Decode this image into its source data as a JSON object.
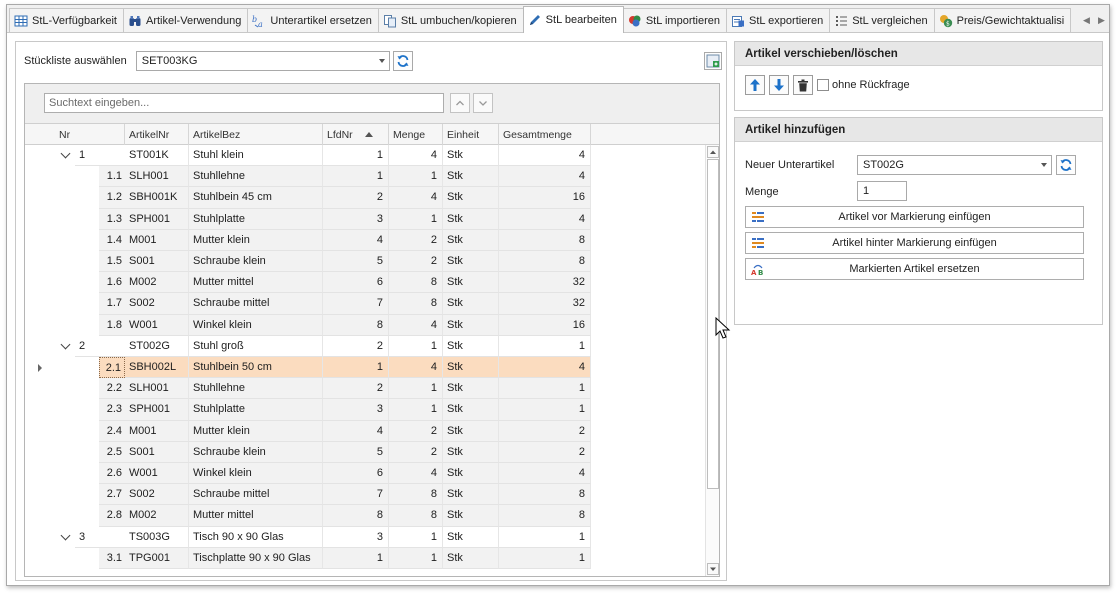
{
  "tabs": [
    {
      "label": "StL-Verfügbarkeit",
      "icon": "grid-icon",
      "active": false
    },
    {
      "label": "Artikel-Verwendung",
      "icon": "binoculars-icon",
      "active": false
    },
    {
      "label": "Unterartikel ersetzen",
      "icon": "replace-text-icon",
      "active": false
    },
    {
      "label": "StL umbuchen/kopieren",
      "icon": "copy-icon",
      "active": false
    },
    {
      "label": "StL bearbeiten",
      "icon": "pen-icon",
      "active": true
    },
    {
      "label": "StL importieren",
      "icon": "import-icon",
      "active": false
    },
    {
      "label": "StL exportieren",
      "icon": "export-icon",
      "active": false
    },
    {
      "label": "StL vergleichen",
      "icon": "compare-list-icon",
      "active": false
    },
    {
      "label": "Preis/Gewichtaktualisi",
      "icon": "price-icon",
      "active": false
    }
  ],
  "left": {
    "select_label": "Stückliste auswählen",
    "select_value": "SET003KG",
    "search_placeholder": "Suchtext eingeben...",
    "columns": {
      "nr": "Nr",
      "artikelnr": "ArtikelNr",
      "artikelbez": "ArtikelBez",
      "lfdnr": "LfdNr",
      "menge": "Menge",
      "einheit": "Einheit",
      "gesamtmenge": "Gesamtmenge"
    },
    "rows": [
      {
        "level": 0,
        "nr": "1",
        "artikelnr": "ST001K",
        "artikelbez": "Stuhl klein",
        "lfdnr": "1",
        "menge": "4",
        "einheit": "Stk",
        "gesamtmenge": "4"
      },
      {
        "level": 1,
        "nr": "1.1",
        "artikelnr": "SLH001",
        "artikelbez": "Stuhllehne",
        "lfdnr": "1",
        "menge": "1",
        "einheit": "Stk",
        "gesamtmenge": "4"
      },
      {
        "level": 1,
        "nr": "1.2",
        "artikelnr": "SBH001K",
        "artikelbez": "Stuhlbein 45 cm",
        "lfdnr": "2",
        "menge": "4",
        "einheit": "Stk",
        "gesamtmenge": "16"
      },
      {
        "level": 1,
        "nr": "1.3",
        "artikelnr": "SPH001",
        "artikelbez": "Stuhlplatte",
        "lfdnr": "3",
        "menge": "1",
        "einheit": "Stk",
        "gesamtmenge": "4"
      },
      {
        "level": 1,
        "nr": "1.4",
        "artikelnr": "M001",
        "artikelbez": "Mutter klein",
        "lfdnr": "4",
        "menge": "2",
        "einheit": "Stk",
        "gesamtmenge": "8"
      },
      {
        "level": 1,
        "nr": "1.5",
        "artikelnr": "S001",
        "artikelbez": "Schraube klein",
        "lfdnr": "5",
        "menge": "2",
        "einheit": "Stk",
        "gesamtmenge": "8"
      },
      {
        "level": 1,
        "nr": "1.6",
        "artikelnr": "M002",
        "artikelbez": "Mutter mittel",
        "lfdnr": "6",
        "menge": "8",
        "einheit": "Stk",
        "gesamtmenge": "32"
      },
      {
        "level": 1,
        "nr": "1.7",
        "artikelnr": "S002",
        "artikelbez": "Schraube mittel",
        "lfdnr": "7",
        "menge": "8",
        "einheit": "Stk",
        "gesamtmenge": "32"
      },
      {
        "level": 1,
        "nr": "1.8",
        "artikelnr": "W001",
        "artikelbez": "Winkel klein",
        "lfdnr": "8",
        "menge": "4",
        "einheit": "Stk",
        "gesamtmenge": "16"
      },
      {
        "level": 0,
        "nr": "2",
        "artikelnr": "ST002G",
        "artikelbez": "Stuhl groß",
        "lfdnr": "2",
        "menge": "1",
        "einheit": "Stk",
        "gesamtmenge": "1"
      },
      {
        "level": 1,
        "nr": "2.1",
        "artikelnr": "SBH002L",
        "artikelbez": "Stuhlbein 50 cm",
        "lfdnr": "1",
        "menge": "4",
        "einheit": "Stk",
        "gesamtmenge": "4",
        "selected": true
      },
      {
        "level": 1,
        "nr": "2.2",
        "artikelnr": "SLH001",
        "artikelbez": "Stuhllehne",
        "lfdnr": "2",
        "menge": "1",
        "einheit": "Stk",
        "gesamtmenge": "1"
      },
      {
        "level": 1,
        "nr": "2.3",
        "artikelnr": "SPH001",
        "artikelbez": "Stuhlplatte",
        "lfdnr": "3",
        "menge": "1",
        "einheit": "Stk",
        "gesamtmenge": "1"
      },
      {
        "level": 1,
        "nr": "2.4",
        "artikelnr": "M001",
        "artikelbez": "Mutter klein",
        "lfdnr": "4",
        "menge": "2",
        "einheit": "Stk",
        "gesamtmenge": "2"
      },
      {
        "level": 1,
        "nr": "2.5",
        "artikelnr": "S001",
        "artikelbez": "Schraube klein",
        "lfdnr": "5",
        "menge": "2",
        "einheit": "Stk",
        "gesamtmenge": "2"
      },
      {
        "level": 1,
        "nr": "2.6",
        "artikelnr": "W001",
        "artikelbez": "Winkel klein",
        "lfdnr": "6",
        "menge": "4",
        "einheit": "Stk",
        "gesamtmenge": "4"
      },
      {
        "level": 1,
        "nr": "2.7",
        "artikelnr": "S002",
        "artikelbez": "Schraube mittel",
        "lfdnr": "7",
        "menge": "8",
        "einheit": "Stk",
        "gesamtmenge": "8"
      },
      {
        "level": 1,
        "nr": "2.8",
        "artikelnr": "M002",
        "artikelbez": "Mutter mittel",
        "lfdnr": "8",
        "menge": "8",
        "einheit": "Stk",
        "gesamtmenge": "8"
      },
      {
        "level": 0,
        "nr": "3",
        "artikelnr": "TS003G",
        "artikelbez": "Tisch 90 x 90 Glas",
        "lfdnr": "3",
        "menge": "1",
        "einheit": "Stk",
        "gesamtmenge": "1"
      },
      {
        "level": 1,
        "nr": "3.1",
        "artikelnr": "TPG001",
        "artikelbez": "Tischplatte 90 x 90 Glas",
        "lfdnr": "1",
        "menge": "1",
        "einheit": "Stk",
        "gesamtmenge": "1"
      }
    ]
  },
  "right": {
    "move_group_title": "Artikel verschieben/löschen",
    "no_confirm_label": "ohne Rückfrage",
    "add_group_title": "Artikel hinzufügen",
    "new_sub_label": "Neuer Unterartikel",
    "new_sub_value": "ST002G",
    "qty_label": "Menge",
    "qty_value": "1",
    "btn_insert_before": "Artikel vor Markierung einfügen",
    "btn_insert_after": "Artikel hinter Markierung einfügen",
    "btn_replace": "Markierten Artikel ersetzen"
  },
  "colors": {
    "accent_blue": "#1d72c9",
    "selection": "#fbdcbf",
    "refresh_green": "#2d8a3e"
  }
}
